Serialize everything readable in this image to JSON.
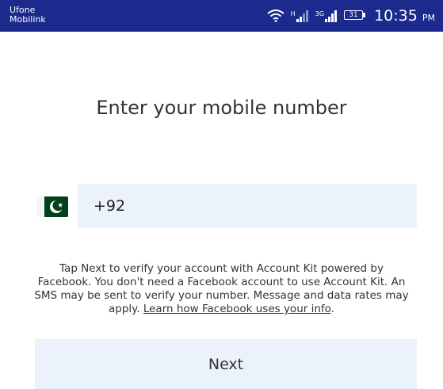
{
  "status_bar": {
    "carrier_1": "Ufone",
    "carrier_2": "Mobilink",
    "signal_1_tag": "H",
    "signal_2_tag": "3G",
    "battery_level": "31",
    "time": "10:35",
    "time_suffix": "PM",
    "background_color": "#1b2a8c"
  },
  "main": {
    "title": "Enter your mobile number",
    "country_flag": "pakistan-flag",
    "phone_input_value": "+92",
    "disclaimer_text": "Tap Next to verify your account with Account Kit powered by Facebook. You don't need a Facebook account to use Account Kit. An SMS may be sent to verify your number. Message and data rates may apply. ",
    "disclaimer_link": "Learn how Facebook uses your info",
    "disclaimer_end": ".",
    "next_button_label": "Next",
    "field_background_color": "#ebf2fc"
  }
}
